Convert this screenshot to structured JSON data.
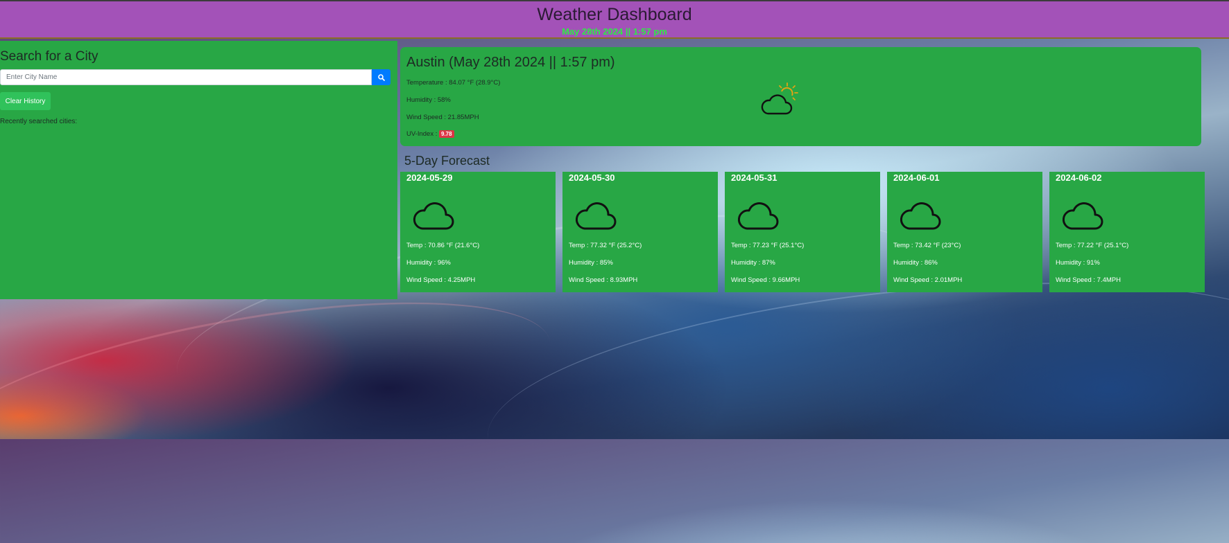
{
  "header": {
    "title": "Weather Dashboard",
    "datetime": "May 28th 2024 || 1:57 pm"
  },
  "sidebar": {
    "heading": "Search for a City",
    "search_placeholder": "Enter City Name",
    "search_icon": "search-icon",
    "clear_label": "Clear History",
    "recent_label": "Recently searched cities:"
  },
  "current": {
    "heading": "Austin (May 28th 2024 || 1:57 pm)",
    "temperature": "Temperature : 84.07 °F (28.9°C)",
    "humidity": "Humidity : 58%",
    "wind": "Wind Speed : 21.85MPH",
    "uv_label": "UV-Index :",
    "uv_value": "9.78",
    "icon": "partly-sunny-icon"
  },
  "forecast": {
    "title": "5-Day Forecast",
    "days": [
      {
        "date": "2024-05-29",
        "icon": "cloud-icon",
        "temp": "Temp : 70.86 °F (21.6°C)",
        "humidity": "Humidity : 96%",
        "wind": "Wind Speed : 4.25MPH"
      },
      {
        "date": "2024-05-30",
        "icon": "cloud-icon",
        "temp": "Temp : 77.32 °F (25.2°C)",
        "humidity": "Humidity : 85%",
        "wind": "Wind Speed : 8.93MPH"
      },
      {
        "date": "2024-05-31",
        "icon": "cloud-icon",
        "temp": "Temp : 77.23 °F (25.1°C)",
        "humidity": "Humidity : 87%",
        "wind": "Wind Speed : 9.66MPH"
      },
      {
        "date": "2024-06-01",
        "icon": "cloud-icon",
        "temp": "Temp : 73.42 °F (23°C)",
        "humidity": "Humidity : 86%",
        "wind": "Wind Speed : 2.01MPH"
      },
      {
        "date": "2024-06-02",
        "icon": "cloud-icon",
        "temp": "Temp : 77.22 °F (25.1°C)",
        "humidity": "Humidity : 91%",
        "wind": "Wind Speed : 7.4MPH"
      }
    ]
  },
  "colors": {
    "header_bg": "#a352b8",
    "panel_green": "#28a745",
    "date_green": "#2eea46",
    "search_blue": "#007bff",
    "uv_red": "#dc3545"
  }
}
